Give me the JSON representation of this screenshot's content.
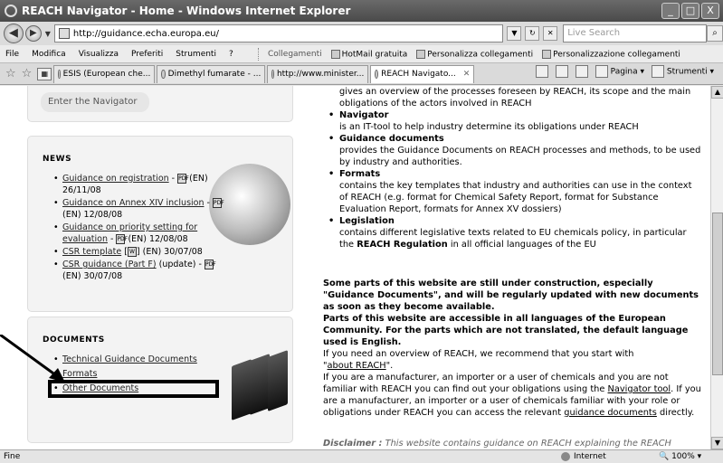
{
  "window": {
    "title": "REACH Navigator - Home - Windows Internet Explorer",
    "buttons": [
      "_",
      "□",
      "X"
    ]
  },
  "address": {
    "url": "http://guidance.echa.europa.eu/",
    "search_placeholder": "Live Search"
  },
  "menu": [
    "File",
    "Modifica",
    "Visualizza",
    "Preferiti",
    "Strumenti",
    "?"
  ],
  "links": [
    "Collegamenti",
    "HotMail gratuita",
    "Personalizza collegamenti",
    "Personalizzazione collegamenti"
  ],
  "tabs": [
    {
      "label": "ESIS (European che..."
    },
    {
      "label": "Dimethyl fumarate - ..."
    },
    {
      "label": "http://www.minister..."
    },
    {
      "label": "REACH Navigato...",
      "active": true
    }
  ],
  "tools": {
    "page": "Pagina",
    "tools": "Strumenti"
  },
  "left": {
    "navigator_button": "Enter the Navigator",
    "news": {
      "heading": "NEWS",
      "items": [
        {
          "link": "Guidance on registration",
          "suffix": " - ",
          "tail": "(EN) 26/11/08"
        },
        {
          "link": "Guidance on Annex XIV inclusion",
          "suffix": " - ",
          "tail": "(EN) 12/08/08"
        },
        {
          "link": "Guidance on priority setting for evaluation",
          "suffix": " - ",
          "tail": "(EN) 12/08/08"
        },
        {
          "link": "CSR template",
          "suffix": " [",
          "tail": "] (EN) 30/07/08"
        },
        {
          "link": "CSR guidance (Part F)",
          "suffix": " (update) - ",
          "tail": "(EN) 30/07/08"
        }
      ]
    },
    "documents": {
      "heading": "DOCUMENTS",
      "items": [
        "Technical Guidance Documents",
        "Formats",
        "Other Documents"
      ]
    }
  },
  "right": {
    "intro": "gives an overview of the processes foreseen by REACH, its scope and the main obligations of the actors involved in REACH",
    "items": [
      {
        "title": "Navigator",
        "desc": "is an IT-tool to help industry determine its obligations under REACH"
      },
      {
        "title": "Guidance documents",
        "desc": "provides the Guidance Documents on REACH processes and methods, to be used by industry and authorities."
      },
      {
        "title": "Formats",
        "desc": "contains the key templates that industry and authorities can use in the context of REACH (e.g. format for Chemical Safety Report, format for Substance Evaluation Report, formats for Annex XV dossiers)"
      },
      {
        "title": "Legislation",
        "desc": "contains different legislative texts related to EU chemicals policy, in particular the",
        "desc_bold": "REACH Regulation",
        "desc_end": "in all official languages of the EU"
      }
    ],
    "notice1": "Some parts of this website are still under construction, especially \"Guidance Documents\", and will be regularly updated with new documents as soon as they become available.",
    "notice2": "Parts of this website are accessible in all languages of the European Community. For the parts which are not translated, the default language used is English.",
    "para1_a": "If you need an overview of REACH, we recommend that you start with",
    "para1_link": "about REACH",
    "para1_b": "\".",
    "para2_a": "If you are a manufacturer, an importer or a user of chemicals and you are not familiar with REACH you can find out your obligations using the",
    "para2_link": "Navigator tool",
    "para2_b": ". If you are a manufacturer, an importer or a user of chemicals familiar with your role or obligations under REACH you can access the relevant",
    "para2_link2": "guidance documents",
    "para2_c": "directly.",
    "disclaimer_label": "Disclaimer :",
    "disclaimer_text": "This website contains guidance on REACH explaining the REACH"
  },
  "status": {
    "left": "Fine",
    "zone": "Internet",
    "zoom": "100%"
  }
}
